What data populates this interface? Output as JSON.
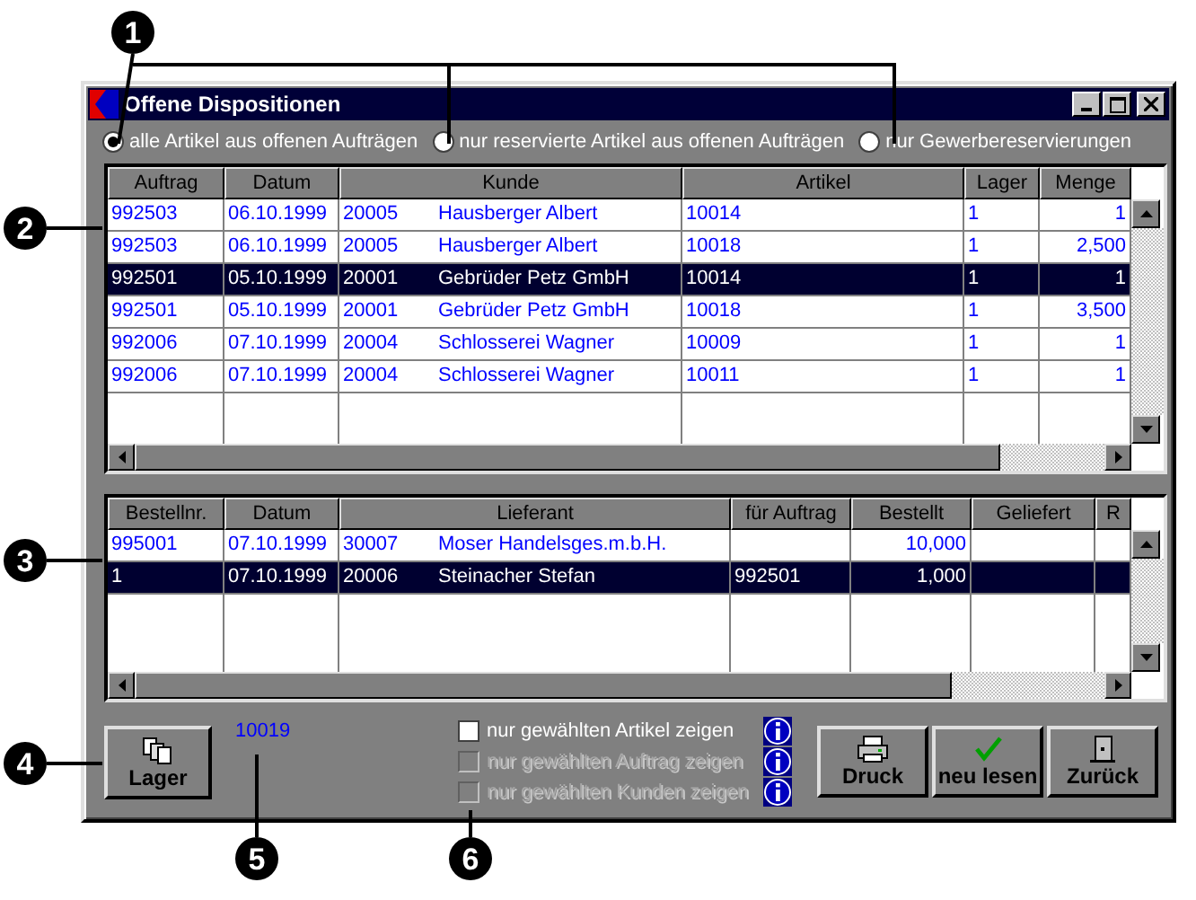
{
  "callouts": [
    "1",
    "2",
    "3",
    "4",
    "5",
    "6"
  ],
  "window": {
    "title": "Offene Dispositionen"
  },
  "radios": [
    {
      "label": "alle Artikel aus offenen Aufträgen",
      "selected": true
    },
    {
      "label": "nur reservierte Artikel aus offenen Aufträgen",
      "selected": false
    },
    {
      "label": "nur Gewerbereservierungen",
      "selected": false
    }
  ],
  "orders": {
    "columns": [
      "Auftrag",
      "Datum",
      "Kunde",
      "Artikel",
      "Lager",
      "Menge"
    ],
    "rows": [
      {
        "cells": [
          "992503",
          "06.10.1999",
          [
            "20005",
            "Hausberger Albert"
          ],
          "10014",
          "1",
          "1"
        ],
        "selected": false
      },
      {
        "cells": [
          "992503",
          "06.10.1999",
          [
            "20005",
            "Hausberger Albert"
          ],
          "10018",
          "1",
          "2,500"
        ],
        "selected": false
      },
      {
        "cells": [
          "992501",
          "05.10.1999",
          [
            "20001",
            "Gebrüder Petz GmbH"
          ],
          "10014",
          "1",
          "1"
        ],
        "selected": true
      },
      {
        "cells": [
          "992501",
          "05.10.1999",
          [
            "20001",
            "Gebrüder Petz GmbH"
          ],
          "10018",
          "1",
          "3,500"
        ],
        "selected": false
      },
      {
        "cells": [
          "992006",
          "07.10.1999",
          [
            "20004",
            "Schlosserei Wagner"
          ],
          "10009",
          "1",
          "1"
        ],
        "selected": false
      },
      {
        "cells": [
          "992006",
          "07.10.1999",
          [
            "20004",
            "Schlosserei Wagner"
          ],
          "10011",
          "1",
          "1"
        ],
        "selected": false
      }
    ]
  },
  "purchases": {
    "columns": [
      "Bestellnr.",
      "Datum",
      "Lieferant",
      "für Auftrag",
      "Bestellt",
      "Geliefert",
      "R"
    ],
    "rows": [
      {
        "cells": [
          "995001",
          "07.10.1999",
          [
            "30007",
            "Moser Handelsges.m.b.H."
          ],
          "",
          "10,000",
          "",
          ""
        ],
        "selected": false
      },
      {
        "cells": [
          "1",
          "07.10.1999",
          [
            "20006",
            "Steinacher Stefan"
          ],
          "992501",
          "1,000",
          "",
          ""
        ],
        "selected": true
      }
    ]
  },
  "stock_button": {
    "label": "Lager"
  },
  "article_number": "10019",
  "filters": [
    {
      "label": "nur gewählten Artikel zeigen",
      "checked": false,
      "disabled": false
    },
    {
      "label": "nur gewählten Auftrag zeigen",
      "checked": false,
      "disabled": true
    },
    {
      "label": "nur gewählten Kunden zeigen",
      "checked": false,
      "disabled": true
    }
  ],
  "buttons": [
    {
      "kind": "print",
      "label": "Druck"
    },
    {
      "kind": "reload",
      "label": "neu lesen"
    },
    {
      "kind": "back",
      "label": "Zurück"
    }
  ]
}
